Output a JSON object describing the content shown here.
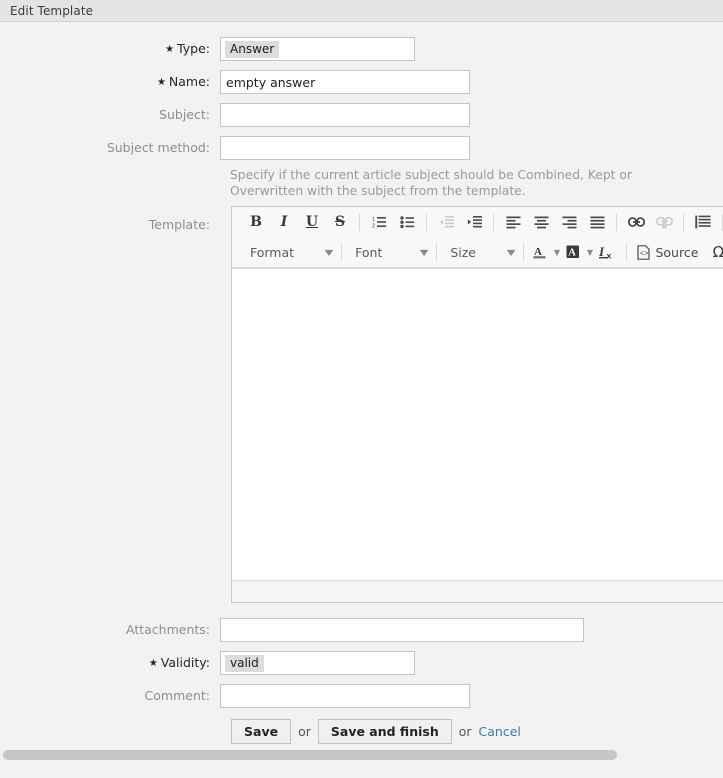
{
  "window": {
    "title": "Edit Template"
  },
  "form": {
    "type": {
      "label": "Type:",
      "required": true,
      "value": "Answer"
    },
    "name": {
      "label": "Name:",
      "required": true,
      "value": "empty answer",
      "placeholder": ""
    },
    "subject": {
      "label": "Subject:",
      "required": false,
      "value": "",
      "placeholder": ""
    },
    "subject_method": {
      "label": "Subject method:",
      "required": false,
      "value": "",
      "placeholder": "",
      "help": "Specify if the current article subject should be Combined, Kept or Overwritten with the subject from the template."
    },
    "template": {
      "label": "Template:"
    },
    "attachments": {
      "label": "Attachments:",
      "required": false,
      "value": "",
      "placeholder": ""
    },
    "validity": {
      "label": "Validity:",
      "required": true,
      "value": "valid"
    },
    "comment": {
      "label": "Comment:",
      "required": false,
      "value": "",
      "placeholder": ""
    }
  },
  "editor": {
    "toolbar_row1": [
      {
        "name": "bold",
        "glyph": "B",
        "enabled": true
      },
      {
        "name": "italic",
        "glyph": "I",
        "enabled": true
      },
      {
        "name": "underline",
        "glyph": "U",
        "enabled": true
      },
      {
        "name": "strikethrough",
        "glyph": "S",
        "enabled": true
      },
      {
        "name": "numbered-list",
        "enabled": true
      },
      {
        "name": "bulleted-list",
        "enabled": true
      },
      {
        "name": "outdent",
        "enabled": false
      },
      {
        "name": "indent",
        "enabled": true
      },
      {
        "name": "align-left",
        "enabled": true
      },
      {
        "name": "align-center",
        "enabled": true
      },
      {
        "name": "align-right",
        "enabled": true
      },
      {
        "name": "align-justify",
        "enabled": true
      },
      {
        "name": "link",
        "enabled": true
      },
      {
        "name": "unlink",
        "enabled": false
      },
      {
        "name": "blockquote",
        "enabled": true
      },
      {
        "name": "undo",
        "enabled": true
      }
    ],
    "format_label": "Format",
    "font_label": "Font",
    "size_label": "Size",
    "text_color_label": "A",
    "bg_color_label": "A",
    "remove_format_label": "I",
    "source_label": "Source",
    "special_char_label": "Ω",
    "content": ""
  },
  "actions": {
    "save": "Save",
    "or_1": "or",
    "save_and_finish": "Save and finish",
    "or_2": "or",
    "cancel": "Cancel"
  }
}
